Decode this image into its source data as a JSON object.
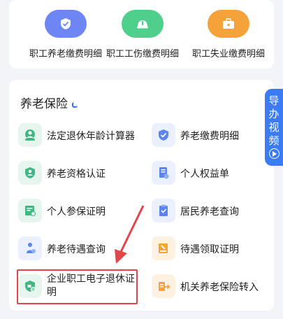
{
  "top_items": [
    {
      "label": "职工养老缴费明细",
      "icon": "shield-check-icon",
      "color": "#6e86f3"
    },
    {
      "label": "职工工伤缴费明细",
      "icon": "helmet-icon",
      "color": "#4fcf8c"
    },
    {
      "label": "职工失业缴费明细",
      "icon": "briefcase-icon",
      "color": "#f5a23a"
    }
  ],
  "section": {
    "title": "养老保险"
  },
  "items": [
    {
      "label": "法定退休年龄计算器",
      "icon": "calculator-person-icon"
    },
    {
      "label": "养老缴费明细",
      "icon": "shield-check-icon"
    },
    {
      "label": "养老资格认证",
      "icon": "person-shield-icon"
    },
    {
      "label": "个人权益单",
      "icon": "document-icon"
    },
    {
      "label": "个人参保证明",
      "icon": "certificate-icon"
    },
    {
      "label": "居民养老查询",
      "icon": "clipboard-icon"
    },
    {
      "label": "养老待遇查询",
      "icon": "elder-person-icon"
    },
    {
      "label": "待遇领取证明",
      "icon": "stamp-icon"
    },
    {
      "label": "企业职工电子退休证明",
      "icon": "shield-document-icon"
    },
    {
      "label": "机关养老保险转入",
      "icon": "transfer-icon"
    }
  ],
  "guide_tab": {
    "label_chars": [
      "导",
      "办",
      "视",
      "频"
    ]
  },
  "colors": {
    "accent": "#3b7cf4",
    "highlight": "#e0464a"
  }
}
